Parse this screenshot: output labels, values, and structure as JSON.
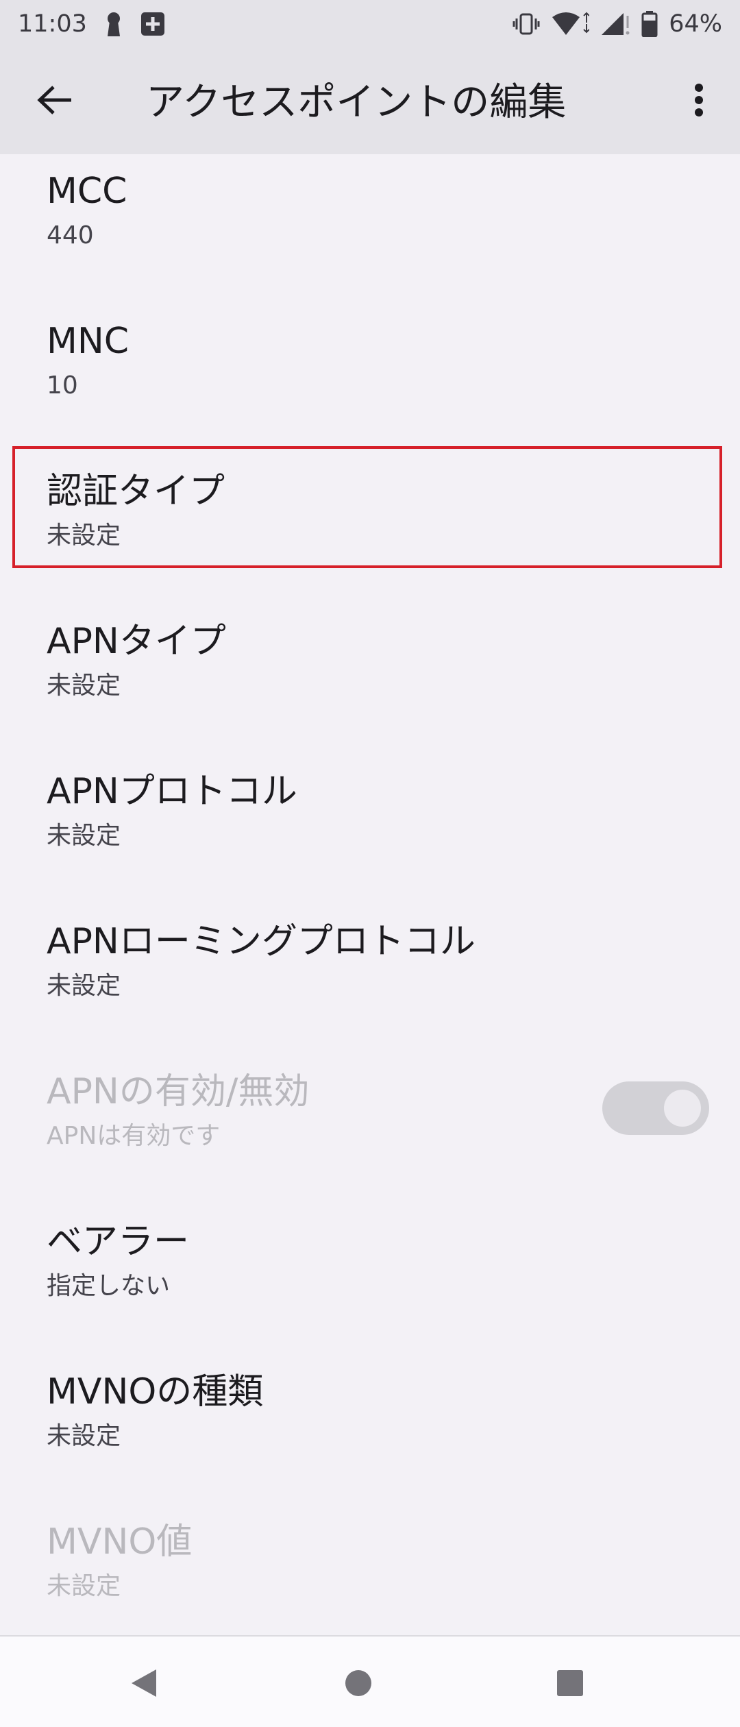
{
  "status_bar": {
    "time": "11:03",
    "battery_percent": "64%",
    "icons": [
      "keyhole-icon",
      "plus-square-icon",
      "vibrate-icon",
      "wifi-icon",
      "signal-icon",
      "battery-icon"
    ]
  },
  "app_bar": {
    "title": "アクセスポイントの編集",
    "back_icon": "arrow-left-icon",
    "more_icon": "more-vert-icon"
  },
  "items": [
    {
      "title": "MCC",
      "summary": "440",
      "enabled": true
    },
    {
      "title": "MNC",
      "summary": "10",
      "enabled": true
    },
    {
      "title": "認証タイプ",
      "summary": "未設定",
      "enabled": true,
      "highlighted": true
    },
    {
      "title": "APNタイプ",
      "summary": "未設定",
      "enabled": true
    },
    {
      "title": "APNプロトコル",
      "summary": "未設定",
      "enabled": true
    },
    {
      "title": "APNローミングプロトコル",
      "summary": "未設定",
      "enabled": true
    },
    {
      "title": "APNの有効/無効",
      "summary": "APNは有効です",
      "enabled": false,
      "toggle_on": true
    },
    {
      "title": "ベアラー",
      "summary": "指定しない",
      "enabled": true
    },
    {
      "title": "MVNOの種類",
      "summary": "未設定",
      "enabled": true
    },
    {
      "title": "MVNO値",
      "summary": "未設定",
      "enabled": false
    }
  ],
  "colors": {
    "background": "#f3f1f6",
    "bar_background": "#e4e3e8",
    "highlight": "#d6202a",
    "disabled_text": "#b9b8bd"
  },
  "nav_bar": {
    "icons": [
      "back-triangle-icon",
      "home-circle-icon",
      "recents-square-icon"
    ]
  }
}
